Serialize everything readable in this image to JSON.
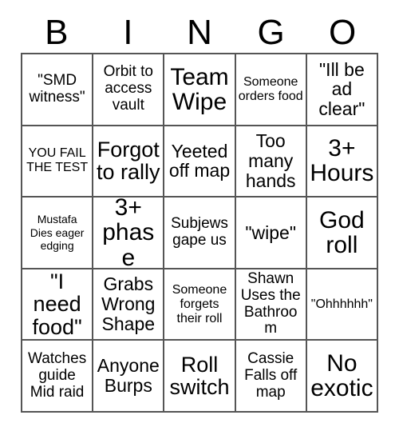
{
  "card": {
    "header_letters": [
      "B",
      "I",
      "N",
      "G",
      "O"
    ],
    "columns": 5,
    "rows": 5,
    "colors": {
      "background": "#ffffff",
      "text": "#000000",
      "grid_line": "#555555"
    },
    "cells": [
      {
        "text": "\"SMD witness\"",
        "size": "md"
      },
      {
        "text": "Orbit to access vault",
        "size": "md"
      },
      {
        "text": "Team Wipe",
        "size": "xxl"
      },
      {
        "text": "Someone orders food",
        "size": "sm"
      },
      {
        "text": "\"Ill be ad clear\"",
        "size": "lg"
      },
      {
        "text": "YOU FAIL THE TEST",
        "size": "sm"
      },
      {
        "text": "Forgot to rally",
        "size": "xl"
      },
      {
        "text": "Yeeted off map",
        "size": "lg"
      },
      {
        "text": "Too many hands",
        "size": "lg"
      },
      {
        "text": "3+ Hours",
        "size": "xxl"
      },
      {
        "text": "Mustafa Dies eager edging",
        "size": "xs"
      },
      {
        "text": "3+ phase",
        "size": "xxl"
      },
      {
        "text": "Subjews gape us",
        "size": "md"
      },
      {
        "text": "\"wipe\"",
        "size": "lg"
      },
      {
        "text": "God roll",
        "size": "xxl"
      },
      {
        "text": "\"I need food\"",
        "size": "xl"
      },
      {
        "text": "Grabs Wrong Shape",
        "size": "lg"
      },
      {
        "text": "Someone forgets their roll",
        "size": "sm"
      },
      {
        "text": "Shawn Uses the Bathroom",
        "size": "md"
      },
      {
        "text": "\"Ohhhhhh\"",
        "size": "sm"
      },
      {
        "text": "Watches guide Mid raid",
        "size": "md"
      },
      {
        "text": "Anyone Burps",
        "size": "lg"
      },
      {
        "text": "Roll switch",
        "size": "xl"
      },
      {
        "text": "Cassie Falls off map",
        "size": "md"
      },
      {
        "text": "No exotic",
        "size": "xxl"
      }
    ]
  }
}
